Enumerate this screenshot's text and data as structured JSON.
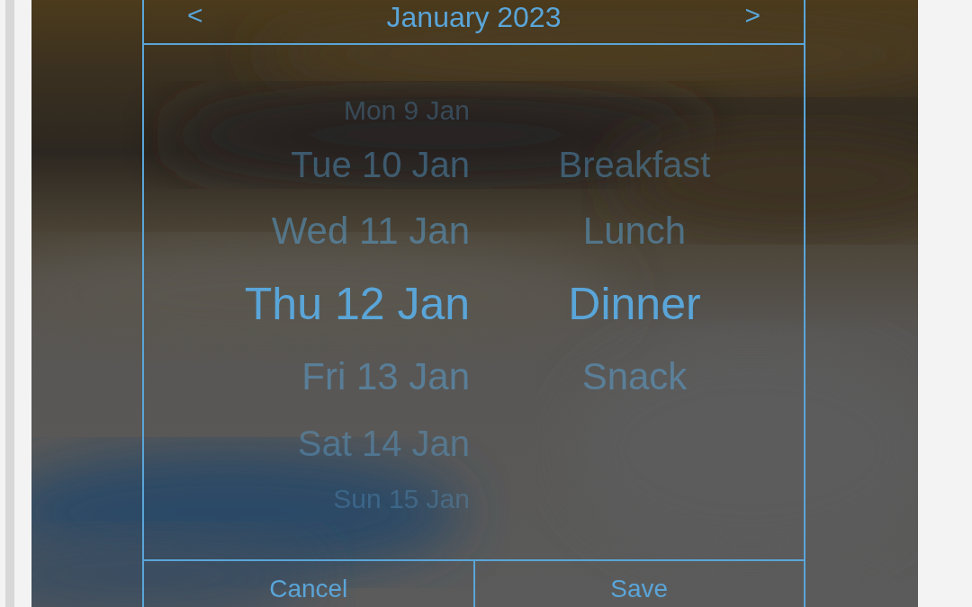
{
  "header": {
    "prev": "<",
    "title": "January 2023",
    "next": ">"
  },
  "wheel": {
    "dates": [
      {
        "label": "Mon 9 Jan",
        "selected": false
      },
      {
        "label": "Tue 10 Jan",
        "selected": false
      },
      {
        "label": "Wed 11 Jan",
        "selected": false
      },
      {
        "label": "Thu 12 Jan",
        "selected": true
      },
      {
        "label": "Fri 13 Jan",
        "selected": false
      },
      {
        "label": "Sat 14 Jan",
        "selected": false
      },
      {
        "label": "Sun 15 Jan",
        "selected": false
      }
    ],
    "meals": [
      {
        "label": "Breakfast",
        "selected": false
      },
      {
        "label": "Lunch",
        "selected": false
      },
      {
        "label": "Dinner",
        "selected": true
      },
      {
        "label": "Snack",
        "selected": false
      }
    ]
  },
  "buttons": [
    {
      "label": "Cancel"
    },
    {
      "label": "Save"
    }
  ]
}
